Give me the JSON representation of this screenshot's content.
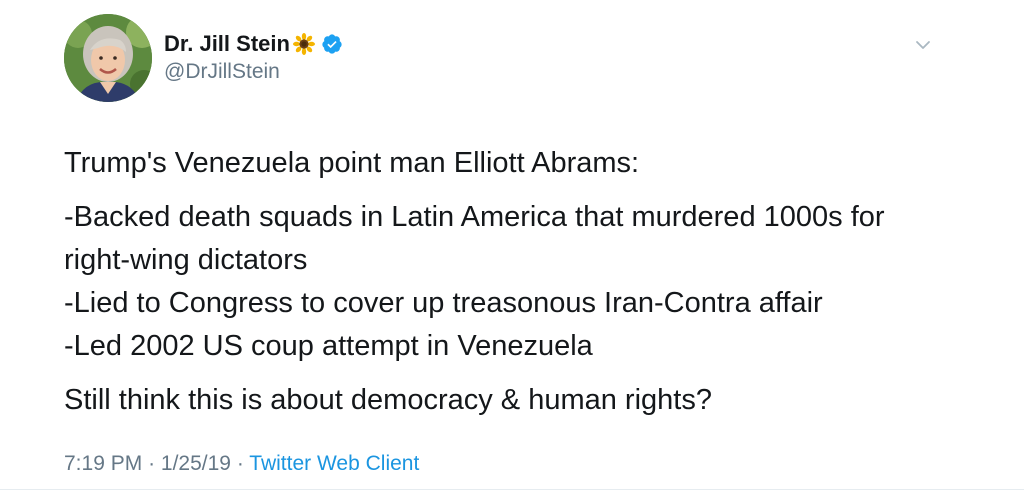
{
  "author": {
    "display_name": "Dr. Jill Stein",
    "handle": "@DrJillStein",
    "emoji_icon": "sunflower-icon",
    "verified_icon": "verified-badge-icon",
    "avatar_icon": "profile-photo-avatar"
  },
  "menu": {
    "caret_icon": "chevron-down-icon"
  },
  "tweet": {
    "intro": "Trump's Venezuela point man Elliott Abrams:",
    "bullets": [
      "-Backed death squads in Latin America that murdered 1000s for",
      "right-wing dictators",
      "-Lied to Congress to cover up treasonous Iran-Contra affair",
      "-Led 2002 US coup attempt in Venezuela"
    ],
    "closing": "Still think this is about democracy & human rights?"
  },
  "meta": {
    "time": "7:19 PM",
    "separator": "·",
    "date": "1/25/19",
    "source": "Twitter Web Client"
  },
  "colors": {
    "text": "#14171a",
    "secondary": "#657786",
    "link": "#1b95e0",
    "verified": "#1da1f2"
  }
}
